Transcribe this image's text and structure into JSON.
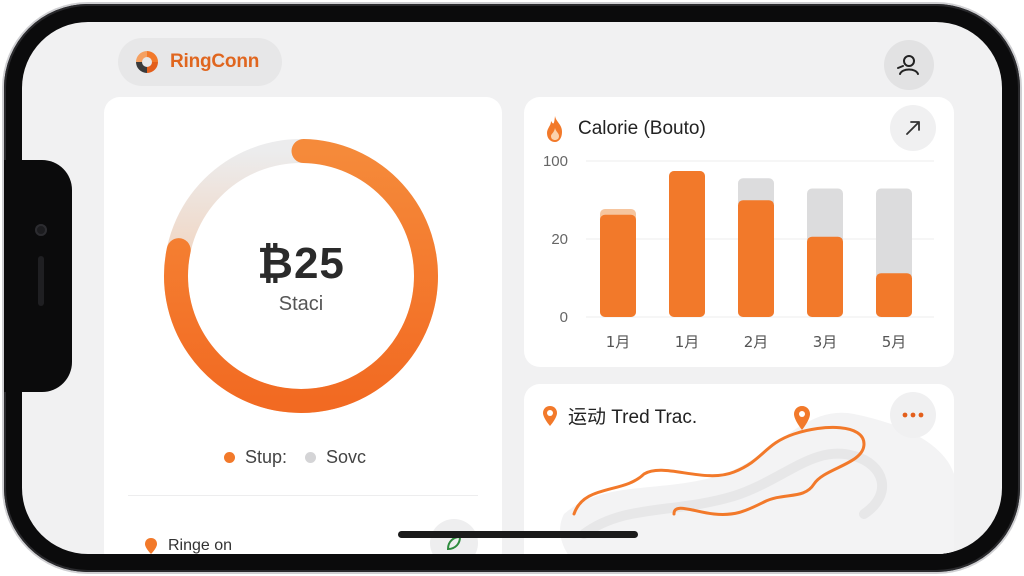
{
  "header": {
    "brand_name": "RingConn"
  },
  "ring_card": {
    "value": "₿25",
    "label": "Staci",
    "progress": 0.78,
    "legend": [
      {
        "label": "Stup:",
        "color": "#f2792a"
      },
      {
        "label": "Sovc",
        "color": "#d4d4d6"
      }
    ],
    "bottom_label": "Ringe on"
  },
  "calorie_card": {
    "title": "Calorie (Bouto)",
    "icon": "flame-icon",
    "chart_data": {
      "type": "bar",
      "categories": [
        "1月",
        "1月",
        "2月",
        "3月",
        "5月"
      ],
      "y_ticks": [
        "100",
        "20",
        "0"
      ],
      "series": [
        {
          "values": [
            70,
            100,
            80,
            55,
            30
          ]
        },
        {
          "values": [
            74,
            100,
            95,
            88,
            88
          ]
        }
      ],
      "ylim": [
        0,
        100
      ]
    }
  },
  "route_card": {
    "title": "运动 Tred Trac.",
    "icon": "location-pin-icon"
  },
  "colors": {
    "accent": "#f2792a",
    "accent_dark": "#e35f1c",
    "track": "#e6e6e7"
  }
}
